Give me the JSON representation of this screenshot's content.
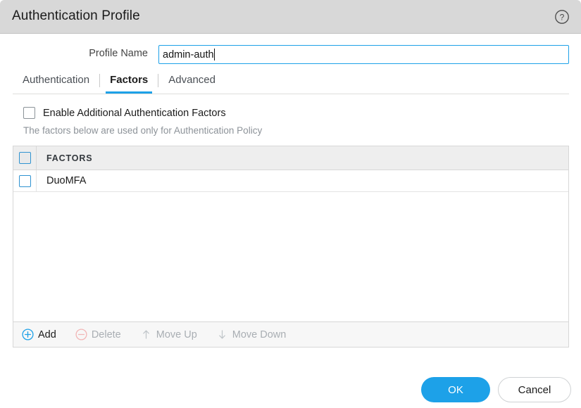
{
  "dialog": {
    "title": "Authentication Profile",
    "help_icon": "help-circle-icon"
  },
  "profile": {
    "label": "Profile Name",
    "value": "admin-auth",
    "placeholder": ""
  },
  "tabs": [
    {
      "label": "Authentication",
      "active": false
    },
    {
      "label": "Factors",
      "active": true
    },
    {
      "label": "Advanced",
      "active": false
    }
  ],
  "enable_factors": {
    "label": "Enable Additional Authentication Factors",
    "checked": false,
    "hint": "The factors below are used only for Authentication Policy"
  },
  "factors_table": {
    "columns": [
      "FACTORS"
    ],
    "select_all_checked": false,
    "rows": [
      {
        "name": "DuoMFA",
        "checked": false
      }
    ],
    "toolbar": [
      {
        "label": "Add",
        "icon": "plus-circle-icon",
        "enabled": true
      },
      {
        "label": "Delete",
        "icon": "minus-circle-icon",
        "enabled": false
      },
      {
        "label": "Move Up",
        "icon": "arrow-up-icon",
        "enabled": false
      },
      {
        "label": "Move Down",
        "icon": "arrow-down-icon",
        "enabled": false
      }
    ]
  },
  "footer": {
    "ok_label": "OK",
    "cancel_label": "Cancel"
  },
  "colors": {
    "accent": "#1da1e8",
    "titlebar": "#d8d8d8",
    "delete_icon": "#f2b6b6",
    "disabled_text": "#a9aeb3"
  }
}
